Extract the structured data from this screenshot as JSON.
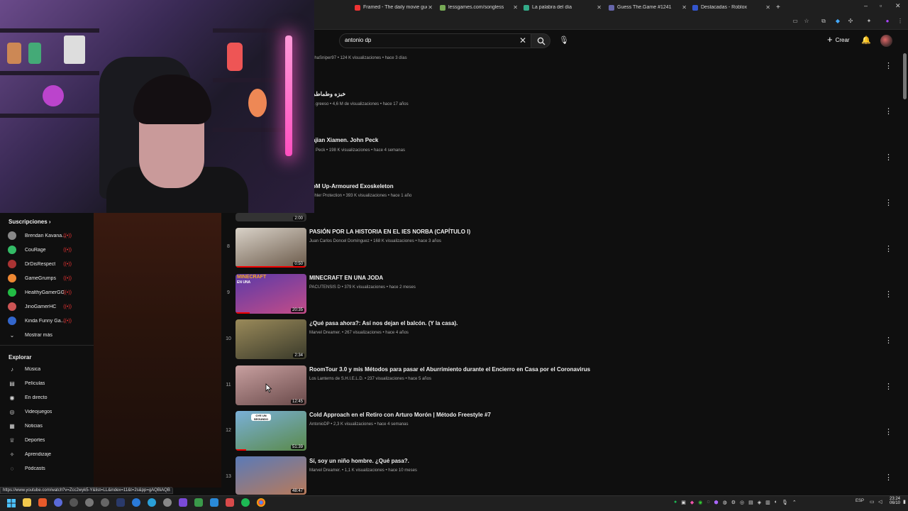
{
  "browser": {
    "tabs": [
      {
        "label": "Framed - The daily movie gues",
        "color": "#e33"
      },
      {
        "label": "lessgames.com/songless",
        "color": "#7a5"
      },
      {
        "label": "La palabra del día",
        "color": "#3a8"
      },
      {
        "label": "Guess The.Game #1241",
        "color": "#66a"
      },
      {
        "label": "Destacadas - Roblox",
        "color": "#35c"
      }
    ],
    "new_tab": "+",
    "status_url": "https://www.youtube.com/watch?v=Zcc2wyk5-Y&list=LL&index=11&t=2s&pp=gAQBiAQB"
  },
  "header": {
    "search_value": "antonio dp",
    "create_label": "Crear"
  },
  "sidebar": {
    "subscriptions_title": "Suscripciones",
    "subscriptions": [
      {
        "label": "Brendan Kavana...",
        "color": "#888"
      },
      {
        "label": "CouRage",
        "color": "#3b6"
      },
      {
        "label": "DrDisRespect",
        "color": "#a33"
      },
      {
        "label": "GameGrumps",
        "color": "#e83"
      },
      {
        "label": "HealthyGamerGG",
        "color": "#2b4"
      },
      {
        "label": "JinoGamerHC",
        "color": "#c55"
      },
      {
        "label": "Kinda Funny Ga...",
        "color": "#36c"
      }
    ],
    "show_more": "Mostrar más",
    "explore_title": "Explorar",
    "explore": [
      {
        "label": "Música",
        "icon": "music-note-icon",
        "glyph": "♪"
      },
      {
        "label": "Películas",
        "icon": "film-icon",
        "glyph": "▤"
      },
      {
        "label": "En directo",
        "icon": "live-icon",
        "glyph": "◉"
      },
      {
        "label": "Videojuegos",
        "icon": "gamepad-icon",
        "glyph": "◎"
      },
      {
        "label": "Noticias",
        "icon": "news-icon",
        "glyph": "▦"
      },
      {
        "label": "Deportes",
        "icon": "trophy-icon",
        "glyph": "♕"
      },
      {
        "label": "Aprendizaje",
        "icon": "lightbulb-icon",
        "glyph": "✧"
      },
      {
        "label": "Pódcasts",
        "icon": "podcast-icon",
        "glyph": "◌"
      }
    ]
  },
  "partial_results": [
    {
      "title": "",
      "meta": "phaSniper97 • 124 K visualizaciones • hace 3 días"
    },
    {
      "title": "خبزه وطماطم",
      "meta": "a greeso • 4,6 M de visualizaciones • hace 17 años"
    },
    {
      "title": "ajian Xiamen. John Peck",
      "meta": "n Peck • 198 K visualizaciones • hace 4 semanas"
    },
    {
      "title": "oM Up-Armoured Exoskeleton",
      "meta": "ohler Protection • 393 K visualizaciones • hace 1 año"
    }
  ],
  "partial_thumb_duration": "2:00",
  "results": [
    {
      "index": "8",
      "title": "PASIÓN POR LA HISTORIA EN EL IES NORBA (CAPÍTULO I)",
      "meta": "Juan Carlos Doncel Domínguez • 168 K visualizaciones • hace 3 años",
      "duration": "0:50",
      "colors": [
        "#d9d2c8",
        "#6b5a4a"
      ],
      "progress": 1.0
    },
    {
      "index": "9",
      "title": "MINECRAFT EN UNA JODA",
      "meta": "PACUTENSIS D • 379 K visualizaciones • hace 2 meses",
      "duration": "20:35",
      "colors": [
        "#5a3aa8",
        "#c44c88"
      ],
      "progress": 0.2,
      "overlay": "MINECRAFT",
      "overlay2": "EN UNA"
    },
    {
      "index": "10",
      "title": "¿Qué pasa ahora?: Así nos dejan el balcón. (Y la casa).",
      "meta": "Marvel Dreamer. • 267 visualizaciones • hace 4 años",
      "duration": "2:34",
      "colors": [
        "#9a8a5a",
        "#3a3a2a"
      ],
      "progress": 0.0
    },
    {
      "index": "11",
      "title": "RoomTour 3.0 y mis Métodos para pasar el Aburrimiento durante el Encierro en Casa por el Coronavirus",
      "meta": "Los Lanterns de S.H.I.E.L.D. • 237 visualizaciones • hace 5 años",
      "duration": "12:45",
      "colors": [
        "#c8a0a0",
        "#6a4a4a"
      ],
      "progress": 0.0
    },
    {
      "index": "12",
      "title": "Cold Approach en el Retiro con Arturo Morón | Método Freestyle #7",
      "meta": "AntonioDP • 2,3 K visualizaciones • hace 4 semanas",
      "duration": "51:39",
      "colors": [
        "#7ab0d8",
        "#5a8a4a"
      ],
      "progress": 0.15,
      "overlay": "OYE UN SEGUNDO"
    },
    {
      "index": "13",
      "title": "Sí, soy un niño hombre. ¿Qué pasa?.",
      "meta": "Marvel Dreamer. • 1,1 K visualizaciones • hace 10 meses",
      "duration": "48:47",
      "colors": [
        "#5a7ab8",
        "#b87a5a"
      ],
      "progress": 0.0
    }
  ],
  "taskbar": {
    "lang": "ESP",
    "time": "23:24",
    "date": "06/10"
  }
}
